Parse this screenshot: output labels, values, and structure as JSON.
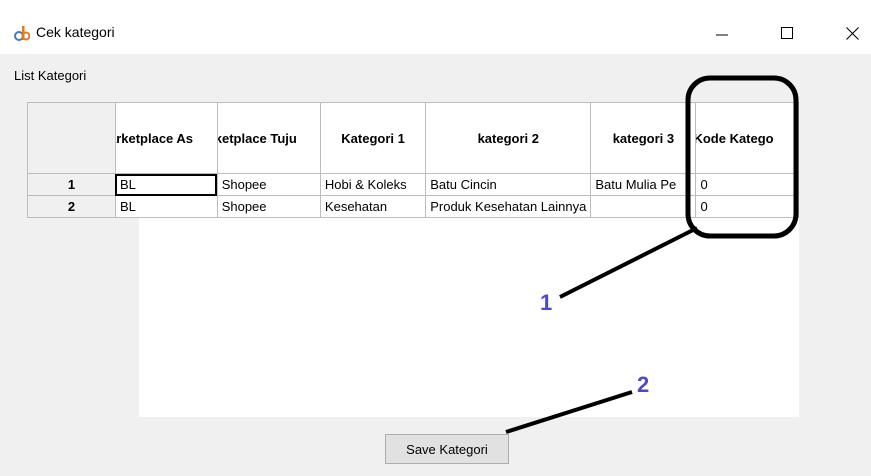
{
  "window": {
    "title": "Cek kategori",
    "icon": "app-logo-icon",
    "controls": [
      "minimize-icon",
      "maximize-icon",
      "close-icon"
    ]
  },
  "section_label": "List Kategori",
  "table": {
    "columns": [
      "",
      "arketplace As",
      "rketplace Tuju",
      "Kategori 1",
      "kategori 2",
      "kategori 3",
      "Kode Katego"
    ],
    "rows": [
      {
        "num": "1",
        "cells": [
          "BL",
          "Shopee",
          "Hobi & Koleks",
          "Batu Cincin",
          "Batu Mulia Pe",
          "0"
        ]
      },
      {
        "num": "2",
        "cells": [
          "BL",
          "Shopee",
          "Kesehatan",
          "Produk Kesehatan Lainnya",
          "",
          "0"
        ]
      }
    ]
  },
  "annotations": {
    "label_1": "1",
    "label_2": "2",
    "stroke_color": "#000000",
    "number_color": "#4b4bd2"
  },
  "save_button": {
    "label": "Save Kategori"
  }
}
